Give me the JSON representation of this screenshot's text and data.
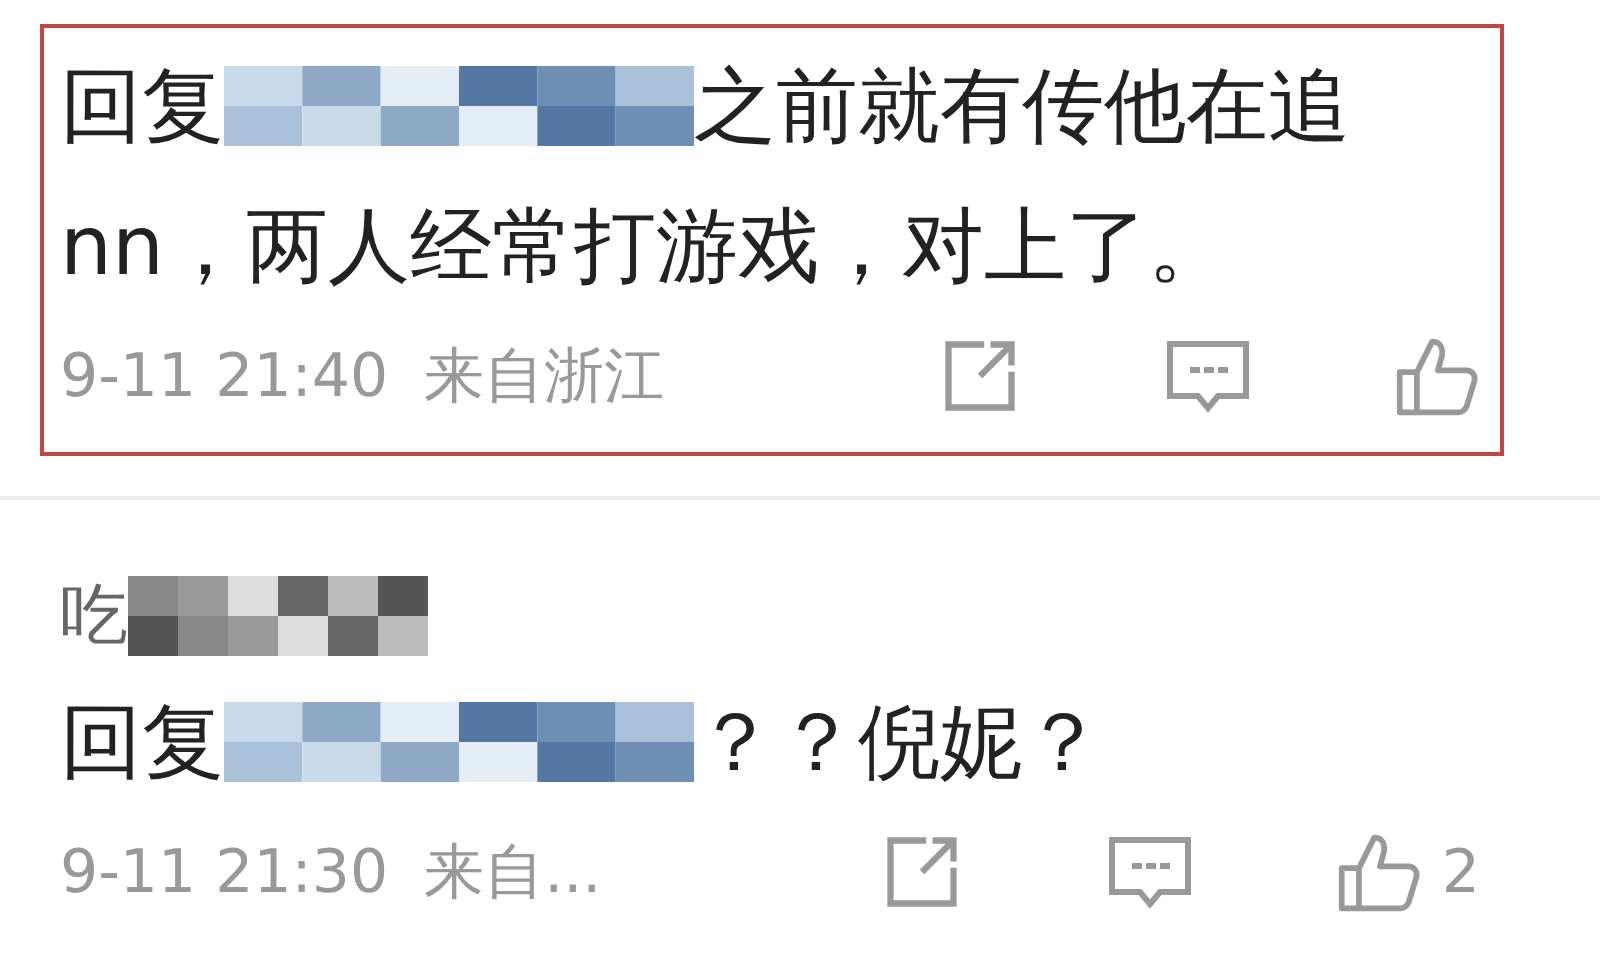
{
  "comments": [
    {
      "highlighted": true,
      "body": [
        {
          "kind": "text",
          "text": "回复"
        },
        {
          "kind": "mosaic"
        },
        {
          "kind": "text",
          "text": "之前就有传他在追"
        },
        {
          "kind": "text",
          "text": "nn，两人经常打游戏，对上了。"
        }
      ],
      "time": "9-11 21:40",
      "source": "来自浙江"
    },
    {
      "highlighted": false,
      "author": [
        {
          "kind": "text",
          "text": "吃"
        },
        {
          "kind": "mosaic"
        }
      ],
      "body": [
        {
          "kind": "text",
          "text": "回复"
        },
        {
          "kind": "mosaic"
        },
        {
          "kind": "text",
          "text": "？？倪妮？"
        }
      ],
      "time": "9-11 21:30",
      "source": "来自...",
      "like_count": "2"
    }
  ]
}
